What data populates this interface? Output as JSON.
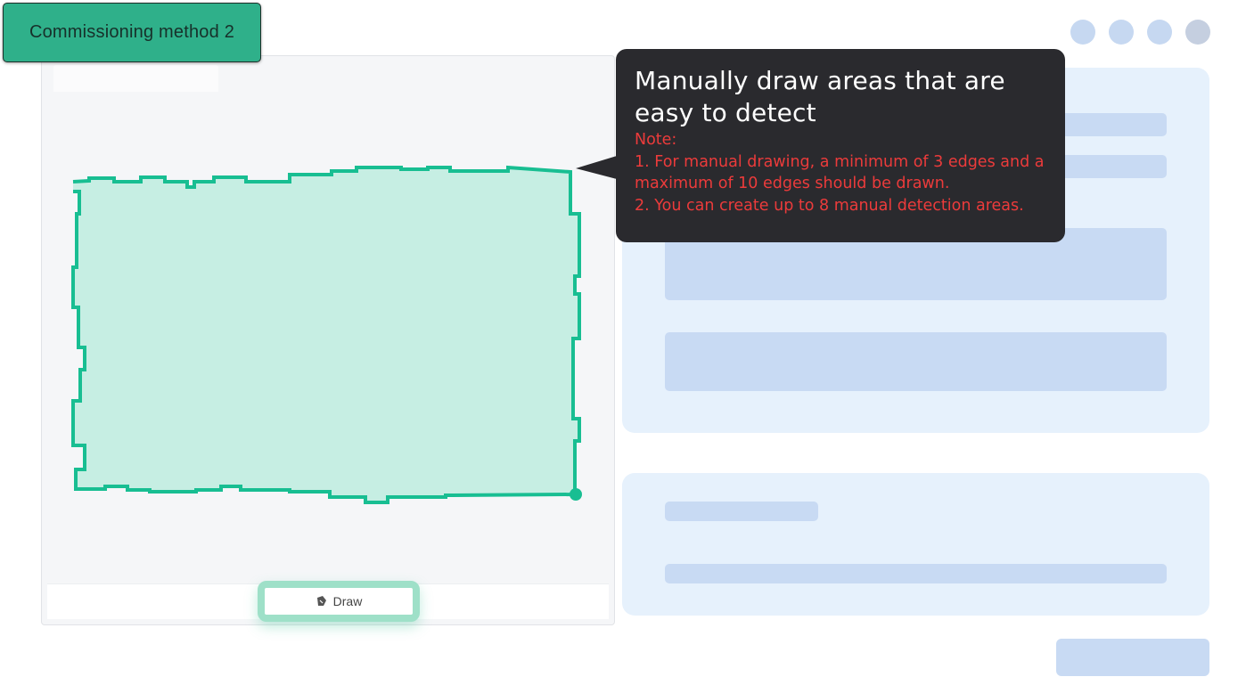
{
  "badge": {
    "label": "Commissioning method 2"
  },
  "canvas": {
    "draw_button_label": "Draw"
  },
  "tooltip": {
    "title": "Manually draw areas that are easy to detect",
    "note_label": "Note:",
    "notes": [
      "1. For manual drawing, a minimum of 3 edges and a maximum of 10 edges should be drawn.",
      "2. You can create up to 8 manual detection areas."
    ]
  },
  "icons": {
    "draw": "pen-icon"
  },
  "colors": {
    "accent": "#2fb08a",
    "area_stroke": "#18be92",
    "area_fill": "#c6eee3",
    "tooltip_bg": "#2a2a2e",
    "note_text": "#ec3b3b",
    "form_card": "#e6f1fc",
    "placeholder_bar": "#c8daf3"
  }
}
